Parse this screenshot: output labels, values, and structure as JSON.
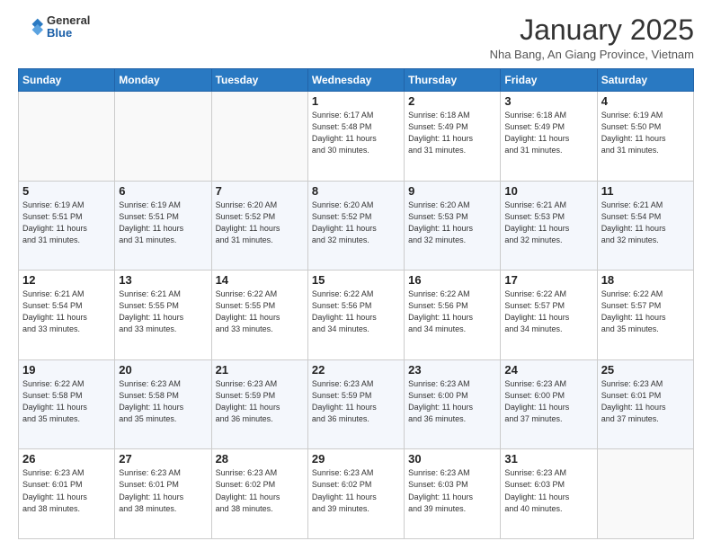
{
  "header": {
    "logo_general": "General",
    "logo_blue": "Blue",
    "month_title": "January 2025",
    "location": "Nha Bang, An Giang Province, Vietnam"
  },
  "days_of_week": [
    "Sunday",
    "Monday",
    "Tuesday",
    "Wednesday",
    "Thursday",
    "Friday",
    "Saturday"
  ],
  "weeks": [
    [
      {
        "day": "",
        "info": ""
      },
      {
        "day": "",
        "info": ""
      },
      {
        "day": "",
        "info": ""
      },
      {
        "day": "1",
        "info": "Sunrise: 6:17 AM\nSunset: 5:48 PM\nDaylight: 11 hours\nand 30 minutes."
      },
      {
        "day": "2",
        "info": "Sunrise: 6:18 AM\nSunset: 5:49 PM\nDaylight: 11 hours\nand 31 minutes."
      },
      {
        "day": "3",
        "info": "Sunrise: 6:18 AM\nSunset: 5:49 PM\nDaylight: 11 hours\nand 31 minutes."
      },
      {
        "day": "4",
        "info": "Sunrise: 6:19 AM\nSunset: 5:50 PM\nDaylight: 11 hours\nand 31 minutes."
      }
    ],
    [
      {
        "day": "5",
        "info": "Sunrise: 6:19 AM\nSunset: 5:51 PM\nDaylight: 11 hours\nand 31 minutes."
      },
      {
        "day": "6",
        "info": "Sunrise: 6:19 AM\nSunset: 5:51 PM\nDaylight: 11 hours\nand 31 minutes."
      },
      {
        "day": "7",
        "info": "Sunrise: 6:20 AM\nSunset: 5:52 PM\nDaylight: 11 hours\nand 31 minutes."
      },
      {
        "day": "8",
        "info": "Sunrise: 6:20 AM\nSunset: 5:52 PM\nDaylight: 11 hours\nand 32 minutes."
      },
      {
        "day": "9",
        "info": "Sunrise: 6:20 AM\nSunset: 5:53 PM\nDaylight: 11 hours\nand 32 minutes."
      },
      {
        "day": "10",
        "info": "Sunrise: 6:21 AM\nSunset: 5:53 PM\nDaylight: 11 hours\nand 32 minutes."
      },
      {
        "day": "11",
        "info": "Sunrise: 6:21 AM\nSunset: 5:54 PM\nDaylight: 11 hours\nand 32 minutes."
      }
    ],
    [
      {
        "day": "12",
        "info": "Sunrise: 6:21 AM\nSunset: 5:54 PM\nDaylight: 11 hours\nand 33 minutes."
      },
      {
        "day": "13",
        "info": "Sunrise: 6:21 AM\nSunset: 5:55 PM\nDaylight: 11 hours\nand 33 minutes."
      },
      {
        "day": "14",
        "info": "Sunrise: 6:22 AM\nSunset: 5:55 PM\nDaylight: 11 hours\nand 33 minutes."
      },
      {
        "day": "15",
        "info": "Sunrise: 6:22 AM\nSunset: 5:56 PM\nDaylight: 11 hours\nand 34 minutes."
      },
      {
        "day": "16",
        "info": "Sunrise: 6:22 AM\nSunset: 5:56 PM\nDaylight: 11 hours\nand 34 minutes."
      },
      {
        "day": "17",
        "info": "Sunrise: 6:22 AM\nSunset: 5:57 PM\nDaylight: 11 hours\nand 34 minutes."
      },
      {
        "day": "18",
        "info": "Sunrise: 6:22 AM\nSunset: 5:57 PM\nDaylight: 11 hours\nand 35 minutes."
      }
    ],
    [
      {
        "day": "19",
        "info": "Sunrise: 6:22 AM\nSunset: 5:58 PM\nDaylight: 11 hours\nand 35 minutes."
      },
      {
        "day": "20",
        "info": "Sunrise: 6:23 AM\nSunset: 5:58 PM\nDaylight: 11 hours\nand 35 minutes."
      },
      {
        "day": "21",
        "info": "Sunrise: 6:23 AM\nSunset: 5:59 PM\nDaylight: 11 hours\nand 36 minutes."
      },
      {
        "day": "22",
        "info": "Sunrise: 6:23 AM\nSunset: 5:59 PM\nDaylight: 11 hours\nand 36 minutes."
      },
      {
        "day": "23",
        "info": "Sunrise: 6:23 AM\nSunset: 6:00 PM\nDaylight: 11 hours\nand 36 minutes."
      },
      {
        "day": "24",
        "info": "Sunrise: 6:23 AM\nSunset: 6:00 PM\nDaylight: 11 hours\nand 37 minutes."
      },
      {
        "day": "25",
        "info": "Sunrise: 6:23 AM\nSunset: 6:01 PM\nDaylight: 11 hours\nand 37 minutes."
      }
    ],
    [
      {
        "day": "26",
        "info": "Sunrise: 6:23 AM\nSunset: 6:01 PM\nDaylight: 11 hours\nand 38 minutes."
      },
      {
        "day": "27",
        "info": "Sunrise: 6:23 AM\nSunset: 6:01 PM\nDaylight: 11 hours\nand 38 minutes."
      },
      {
        "day": "28",
        "info": "Sunrise: 6:23 AM\nSunset: 6:02 PM\nDaylight: 11 hours\nand 38 minutes."
      },
      {
        "day": "29",
        "info": "Sunrise: 6:23 AM\nSunset: 6:02 PM\nDaylight: 11 hours\nand 39 minutes."
      },
      {
        "day": "30",
        "info": "Sunrise: 6:23 AM\nSunset: 6:03 PM\nDaylight: 11 hours\nand 39 minutes."
      },
      {
        "day": "31",
        "info": "Sunrise: 6:23 AM\nSunset: 6:03 PM\nDaylight: 11 hours\nand 40 minutes."
      },
      {
        "day": "",
        "info": ""
      }
    ]
  ]
}
